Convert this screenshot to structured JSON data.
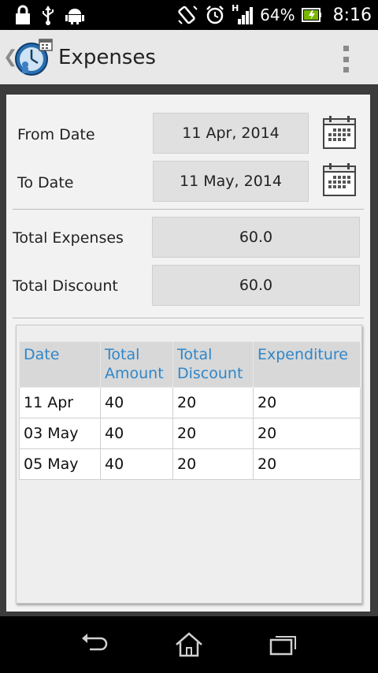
{
  "status_bar": {
    "battery_percent": "64%",
    "time": "8:16",
    "network": "H",
    "left_icons": [
      "lock-icon",
      "usb-icon",
      "android-icon"
    ],
    "right_icons": [
      "rotate-icon",
      "alarm-icon",
      "signal-icon",
      "battery-icon"
    ]
  },
  "action_bar": {
    "title": "Expenses",
    "back_icon": "chevron-left-icon",
    "app_icon": "app-logo-icon",
    "menu_icon": "overflow-menu-icon"
  },
  "form": {
    "from_label": "From Date",
    "from_value": "11 Apr, 2014",
    "to_label": "To Date",
    "to_value": "11 May, 2014",
    "calendar_icon": "calendar-icon"
  },
  "summary": {
    "total_expenses_label": "Total Expenses",
    "total_expenses_value": "60.0",
    "total_discount_label": "Total Discount",
    "total_discount_value": "60.0"
  },
  "table": {
    "headers": [
      "Date",
      "Total Amount",
      "Total Discount",
      "Expenditure"
    ],
    "rows": [
      [
        "11 Apr",
        "40",
        "20",
        "20"
      ],
      [
        "03 May",
        "40",
        "20",
        "20"
      ],
      [
        "05 May",
        "40",
        "20",
        "20"
      ]
    ]
  },
  "nav_bar": {
    "icons": [
      "back-icon",
      "home-icon",
      "recent-apps-icon"
    ]
  },
  "colors": {
    "header_text": "#2f86c9",
    "action_bar_bg": "#e8e8e8",
    "panel_bg": "#f2f2f2",
    "field_bg": "#e0e0e0"
  }
}
